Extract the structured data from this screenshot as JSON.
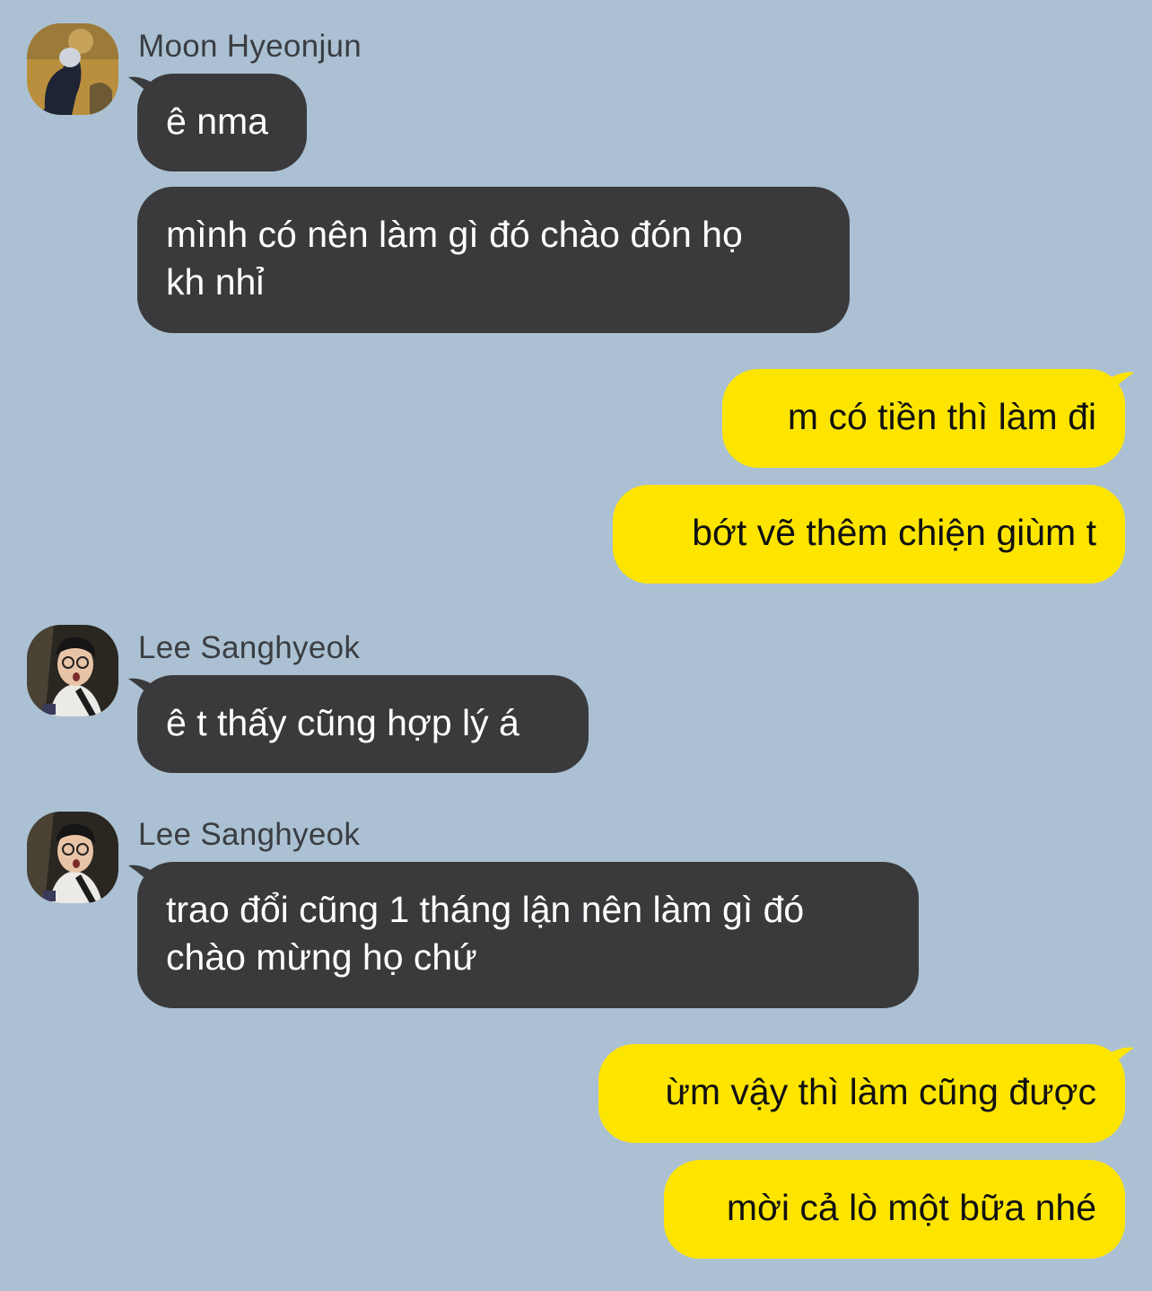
{
  "colors": {
    "background": "#abc1d3",
    "incoming_bubble": "#3a3a3d",
    "outgoing_bubble": "#fee500"
  },
  "groups": [
    {
      "sender": "Moon Hyeonjun",
      "avatar": "avatar-hyeonjun",
      "messages": [
        "ê nma",
        "mình có nên làm gì đó chào đón họ\nkh nhỉ"
      ]
    },
    {
      "sender": "me",
      "messages": [
        "m có tiền thì làm đi",
        "bớt vẽ thêm chiện giùm t"
      ]
    },
    {
      "sender": "Lee Sanghyeok",
      "avatar": "avatar-sanghyeok",
      "messages": [
        "ê t thấy cũng hợp lý á"
      ]
    },
    {
      "sender": "Lee Sanghyeok",
      "avatar": "avatar-sanghyeok",
      "messages": [
        "trao đổi cũng 1 tháng lận nên làm gì đó\nchào mừng họ chứ"
      ]
    },
    {
      "sender": "me",
      "messages": [
        "ừm vậy thì làm cũng được",
        "mời cả lò một bữa nhé"
      ]
    }
  ]
}
